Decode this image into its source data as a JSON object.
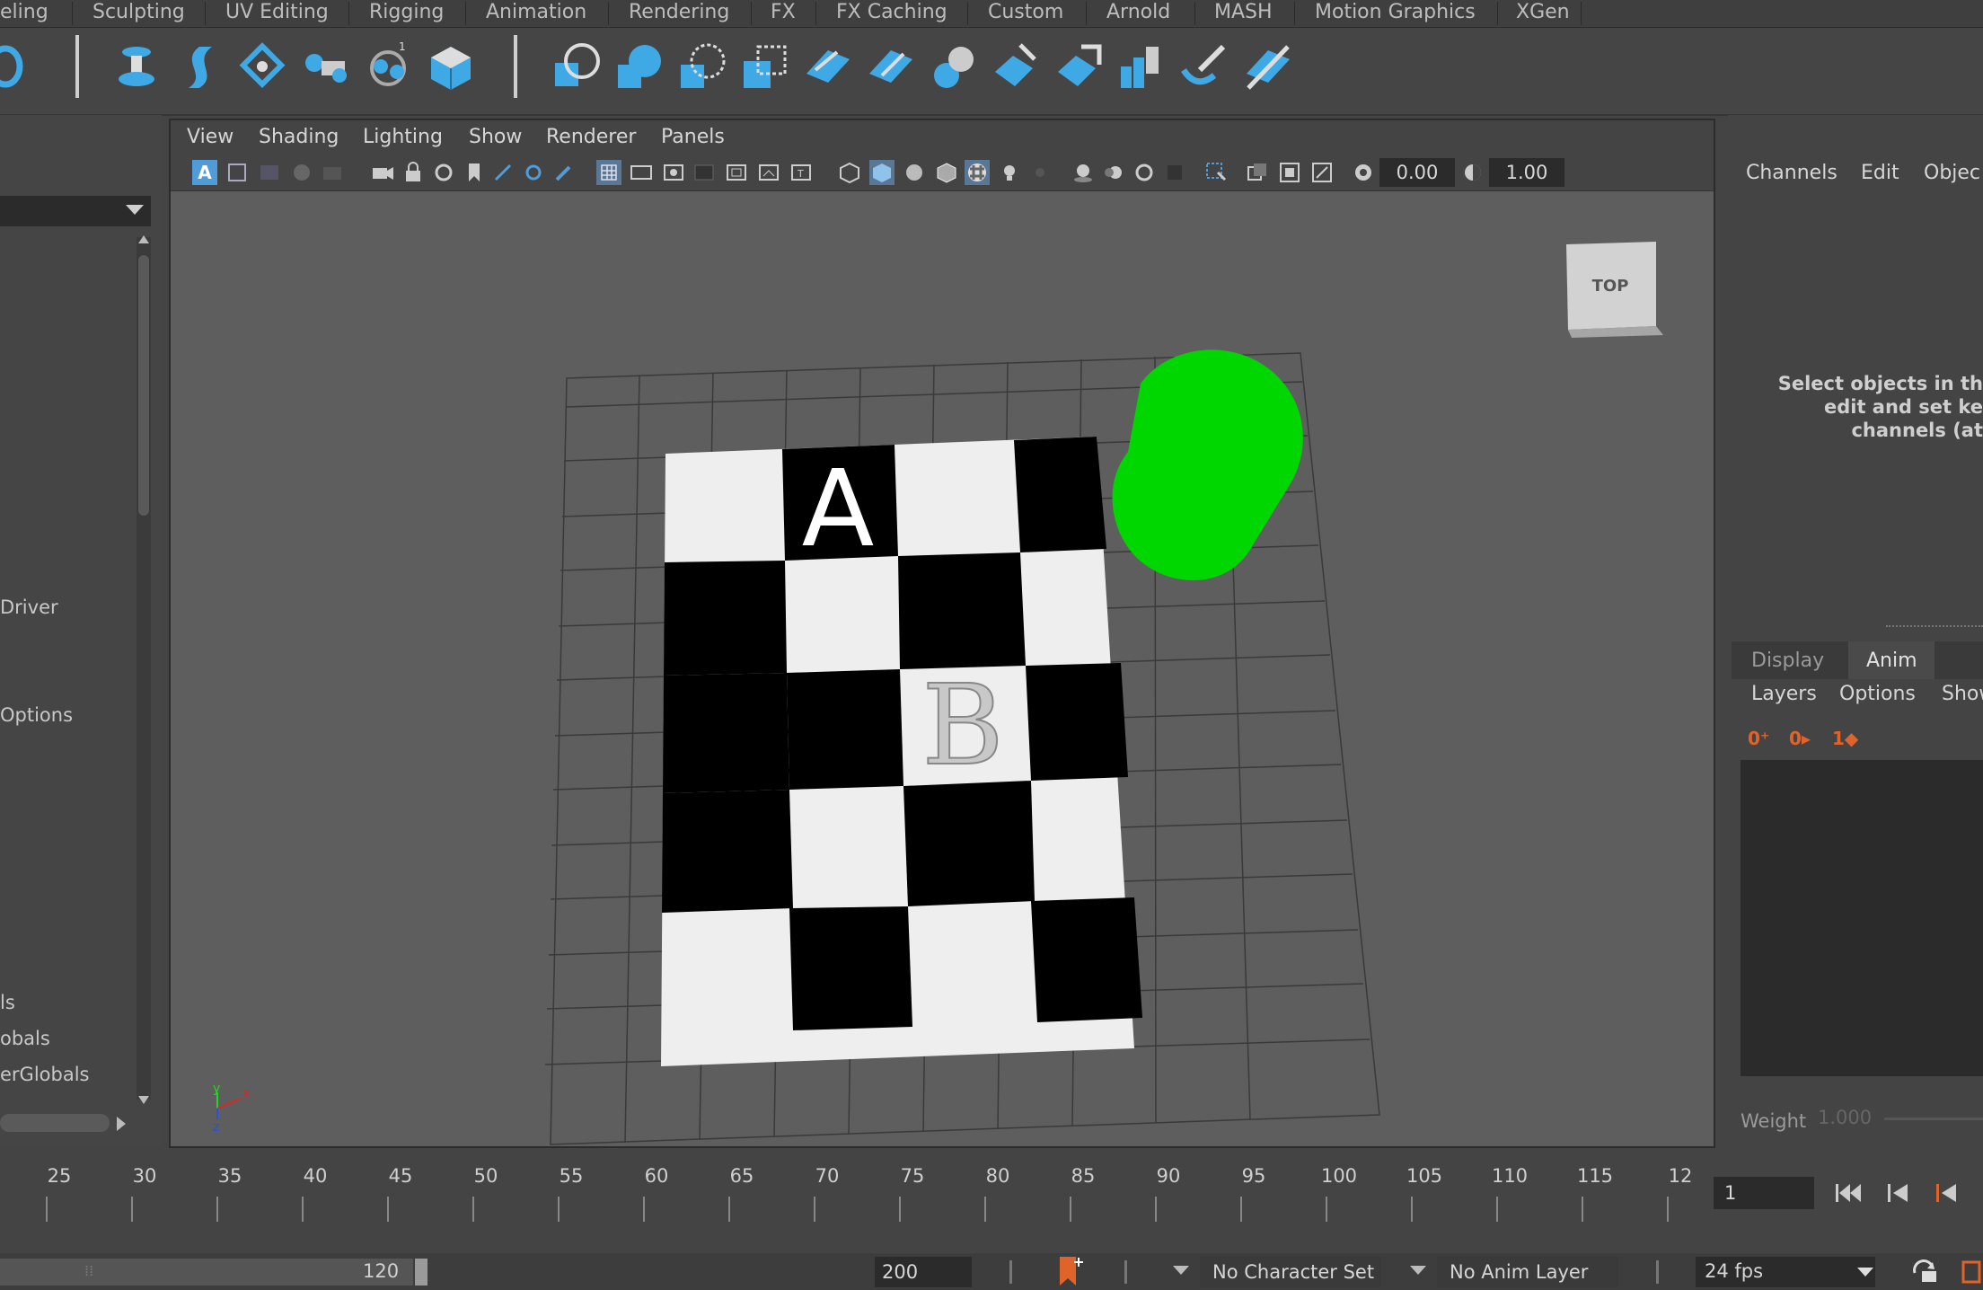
{
  "menubar": {
    "tabs": [
      "eling",
      "Sculpting",
      "UV Editing",
      "Rigging",
      "Animation",
      "Rendering",
      "FX",
      "FX Caching",
      "Custom",
      "Arnold",
      "MASH",
      "Motion Graphics",
      "XGen"
    ]
  },
  "shelf": {
    "icons": [
      "fluid-icon",
      "deformer-icon",
      "curve-icon",
      "lattice-icon",
      "camera-cluster-icon",
      "camera-aim-icon",
      "cube-icon",
      "soft-mod-icon",
      "sphere-icon",
      "deform-icon",
      "polygon-icon",
      "plane-icon",
      "plane-2-icon",
      "sphere-split-icon",
      "diamond-icon",
      "arrow-icon",
      "bar-graph-icon",
      "paint-icon",
      "slash-icon"
    ]
  },
  "left_panel": {
    "items": [
      "Driver",
      "Options",
      "ls",
      "obals",
      "erGlobals"
    ]
  },
  "viewport": {
    "menus": [
      "View",
      "Shading",
      "Lighting",
      "Show",
      "Renderer",
      "Panels"
    ],
    "exposure_value": "0.00",
    "gamma_value": "1.00",
    "viewcube_label": "TOP",
    "board_letters": [
      "A",
      "B"
    ],
    "axis_labels": {
      "y": "y",
      "x": "x",
      "z": "z"
    },
    "colors": {
      "sphere": "#00d600",
      "board_dark": "#000000",
      "board_light": "#eeeeee"
    }
  },
  "channel_box": {
    "menus": [
      "Channels",
      "Edit",
      "Objec"
    ],
    "hint_lines": [
      "Select objects in th",
      "edit and set ke",
      "channels (at"
    ]
  },
  "layer_panel": {
    "tabs": [
      "Display",
      "Anim"
    ],
    "menus": [
      "Layers",
      "Options",
      "Show"
    ],
    "weight_label": "Weight",
    "weight_value": "1.000"
  },
  "timeline": {
    "ticks": [
      "25",
      "30",
      "35",
      "40",
      "45",
      "50",
      "55",
      "60",
      "65",
      "70",
      "75",
      "80",
      "85",
      "90",
      "95",
      "100",
      "105",
      "110",
      "115",
      "12"
    ],
    "current_frame": "1"
  },
  "range_bar": {
    "end_time": "120",
    "max_time": "200",
    "character_set": "No Character Set",
    "anim_layer": "No Anim Layer",
    "fps": "24 fps"
  }
}
